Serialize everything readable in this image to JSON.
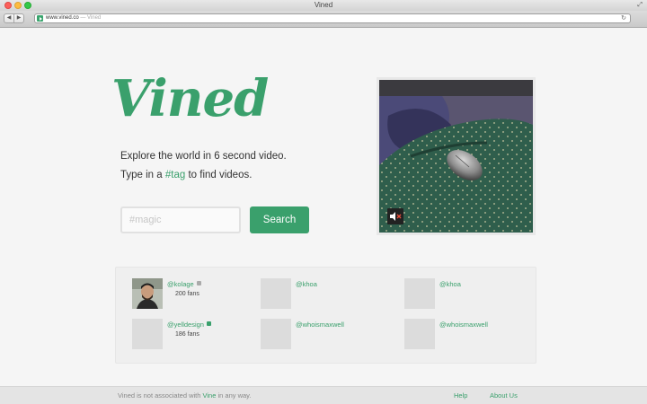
{
  "window": {
    "title": "Vined"
  },
  "browser": {
    "url": "www.vined.co",
    "url_suffix": "— Vined"
  },
  "logo": {
    "text": "Vined"
  },
  "tagline": {
    "line1": "Explore the world in 6 second video.",
    "line2_prefix": "Type in a ",
    "line2_tag": "#tag",
    "line2_suffix": " to find videos."
  },
  "search": {
    "placeholder": "#magic",
    "value": "",
    "button_label": "Search"
  },
  "video": {
    "muted": true,
    "mute_icon": "speaker-muted-icon"
  },
  "users": [
    {
      "name": "@kolage",
      "fans": "200 fans",
      "has_photo": true,
      "status_color": "#aaaaaa"
    },
    {
      "name": "@khoa",
      "fans": "",
      "has_photo": false,
      "status_color": ""
    },
    {
      "name": "@khoa",
      "fans": "",
      "has_photo": false,
      "status_color": ""
    },
    {
      "name": "@yelldesign",
      "fans": "186 fans",
      "has_photo": false,
      "status_color": "#3aa06c"
    },
    {
      "name": "@whoismaxwell",
      "fans": "",
      "has_photo": false,
      "status_color": ""
    },
    {
      "name": "@whoismaxwell",
      "fans": "",
      "has_photo": false,
      "status_color": ""
    }
  ],
  "footer": {
    "text_prefix": "Vined is not associated with ",
    "text_brand": "Vine",
    "text_suffix": " in any way.",
    "help": "Help",
    "about": "About Us"
  },
  "colors": {
    "brand_green": "#3aa06c",
    "page_bg": "#f5f5f5"
  }
}
